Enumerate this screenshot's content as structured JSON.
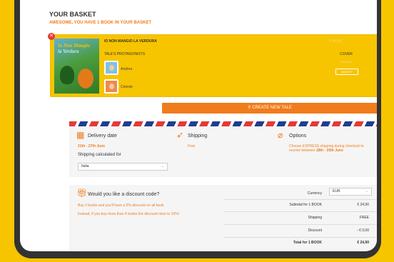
{
  "header": {
    "title": "YOUR BASKET",
    "subtitle": "AWESOME, YOU HAVE 1 BOOK IN YOUR BASKET"
  },
  "basket_item": {
    "book_name": "IO NON MANGIO LA VERDURA",
    "price": "€ 24,90",
    "cover_title_line1": "Io Non Mangio",
    "cover_title_line2": "la Verdura",
    "protagonists_label": "TALE'S PROTAGONISTS",
    "protagonists": [
      {
        "name": "Andrea"
      },
      {
        "name": "Celeste"
      }
    ],
    "cover_label": "COVER",
    "cover_value": "Softcover",
    "modify_label": "MODIFY"
  },
  "create_button": {
    "icon": "magic-wand-icon",
    "label": "CREATE NEW TALE"
  },
  "delivery": {
    "date_title": "Delivery date",
    "date_value": "21th - 27th June",
    "shipping_calc_label": "Shipping calculated for",
    "country_selected": "Italia",
    "shipping_title": "Shipping",
    "shipping_value": "Free",
    "options_title": "Options",
    "options_text": "Choose EXPRESS shipping during checkout to receive between ",
    "options_highlight": "18th - 20th June"
  },
  "discount": {
    "title": "Would you like a discount code?",
    "line1": "Buy 2 books and you'll have a 5% discount on all book",
    "line2": "Instead, if you buy more than 4 books the discount rises to 10%!"
  },
  "totals": {
    "currency_label": "Currency",
    "currency_selected": "EUR",
    "subtotal_label": "Subtotal for 1 BOOK",
    "subtotal_value": "€ 24,90",
    "shipping_label": "Shipping",
    "shipping_value": "FREE",
    "discount_label": "Discount",
    "discount_value": "- € 0,00",
    "total_label": "Total for 1 BOOK",
    "total_value": "€ 24,90"
  },
  "colors": {
    "accent": "#f07c1c",
    "basket_bg": "#f7c400",
    "panel_bg": "#f5f5f5"
  }
}
